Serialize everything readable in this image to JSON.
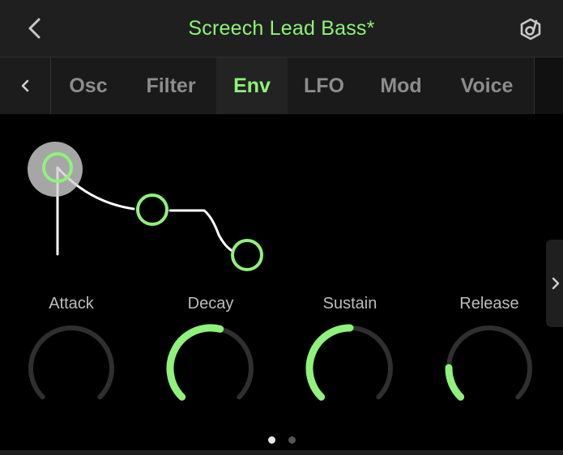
{
  "header": {
    "title": "Screech Lead Bass*",
    "back_icon": "chevron-left-icon",
    "brand_icon": "app-logo-icon"
  },
  "tabs": {
    "prev_icon": "chevron-left-icon",
    "items": [
      {
        "label": "Osc",
        "active": false
      },
      {
        "label": "Filter",
        "active": false
      },
      {
        "label": "Env",
        "active": true
      },
      {
        "label": "LFO",
        "active": false
      },
      {
        "label": "Mod",
        "active": false
      },
      {
        "label": "Voice",
        "active": false
      }
    ]
  },
  "envelope": {
    "points": [
      "attack",
      "decay",
      "sustain-release"
    ],
    "selected": "attack"
  },
  "knobs": [
    {
      "label": "Attack",
      "value": 0.0
    },
    {
      "label": "Decay",
      "value": 0.55
    },
    {
      "label": "Sustain",
      "value": 0.5
    },
    {
      "label": "Release",
      "value": 0.17
    }
  ],
  "pager": {
    "pages": 2,
    "current": 1
  },
  "colors": {
    "accent": "#8ff27a",
    "track": "#2f2f2f",
    "background": "#000000",
    "header_bg": "#1f1f1f"
  }
}
